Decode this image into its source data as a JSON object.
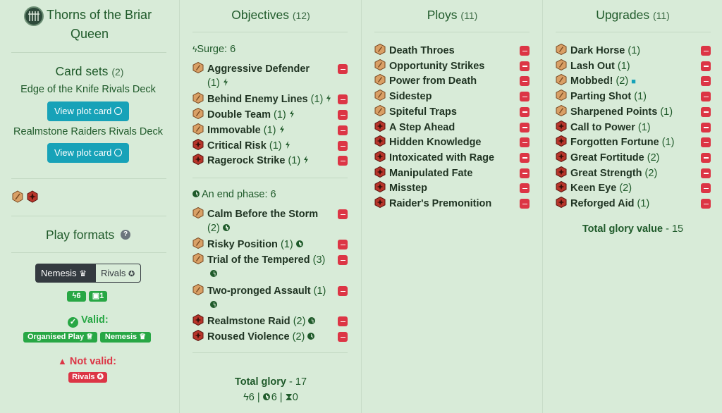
{
  "faction": {
    "name_line1": "Thorns of the Briar",
    "name_line2": "Queen",
    "icon": "briar-queen-crest-icon"
  },
  "card_sets": {
    "title": "Card sets",
    "count": "(2)",
    "sets": [
      {
        "name": "Edge of the Knife Rivals Deck",
        "button": "View plot card"
      },
      {
        "name": "Realmstone Raiders Rivals Deck",
        "button": "View plot card"
      }
    ]
  },
  "play_formats": {
    "title": "Play formats",
    "toggle": {
      "nemesis": "Nemesis",
      "rivals": "Rivals",
      "selected": "Nemesis"
    },
    "stat_surge": "6",
    "stat_lock": "1",
    "valid_label": "Valid:",
    "valid_badges": [
      "Organised Play",
      "Nemesis"
    ],
    "invalid_label": "Not valid:",
    "invalid_badges": [
      "Rivals"
    ]
  },
  "objectives": {
    "title": "Objectives",
    "count": "(12)",
    "surge_header": "Surge: 6",
    "end_header": "An end phase: 6",
    "surge_items": [
      {
        "name": "Aggressive Defender",
        "count": "(1)",
        "set": "edge"
      },
      {
        "name": "Behind Enemy Lines",
        "count": "(1)",
        "set": "edge"
      },
      {
        "name": "Double Team",
        "count": "(1)",
        "set": "edge"
      },
      {
        "name": "Immovable",
        "count": "(1)",
        "set": "edge"
      },
      {
        "name": "Critical Risk",
        "count": "(1)",
        "set": "realm"
      },
      {
        "name": "Ragerock Strike",
        "count": "(1)",
        "set": "realm"
      }
    ],
    "end_items": [
      {
        "name": "Calm Before the Storm",
        "count": "(2)",
        "set": "edge"
      },
      {
        "name": "Risky Position",
        "count": "(1)",
        "set": "edge"
      },
      {
        "name": "Trial of the Tempered",
        "count": "(3)",
        "set": "edge"
      },
      {
        "name": "Two-pronged Assault",
        "count": "(1)",
        "set": "edge"
      },
      {
        "name": "Realmstone Raid",
        "count": "(2)",
        "set": "realm"
      },
      {
        "name": "Roused Violence",
        "count": "(2)",
        "set": "realm"
      }
    ],
    "total_label": "Total glory",
    "total_value": "- 17",
    "summary": {
      "surge": "6",
      "end": "6",
      "other": "0"
    }
  },
  "ploys": {
    "title": "Ploys",
    "count": "(11)",
    "items": [
      {
        "name": "Death Throes",
        "set": "edge"
      },
      {
        "name": "Opportunity Strikes",
        "set": "edge"
      },
      {
        "name": "Power from Death",
        "set": "edge"
      },
      {
        "name": "Sidestep",
        "set": "edge"
      },
      {
        "name": "Spiteful Traps",
        "set": "edge"
      },
      {
        "name": "A Step Ahead",
        "set": "realm"
      },
      {
        "name": "Hidden Knowledge",
        "set": "realm"
      },
      {
        "name": "Intoxicated with Rage",
        "set": "realm"
      },
      {
        "name": "Manipulated Fate",
        "set": "realm"
      },
      {
        "name": "Misstep",
        "set": "realm"
      },
      {
        "name": "Raider's Premonition",
        "set": "realm"
      }
    ]
  },
  "upgrades": {
    "title": "Upgrades",
    "count": "(11)",
    "items": [
      {
        "name": "Dark Horse",
        "count": "(1)",
        "set": "edge"
      },
      {
        "name": "Lash Out",
        "count": "(1)",
        "set": "edge"
      },
      {
        "name": "Mobbed!",
        "count": "(2)",
        "set": "edge",
        "locked": true
      },
      {
        "name": "Parting Shot",
        "count": "(1)",
        "set": "edge"
      },
      {
        "name": "Sharpened Points",
        "count": "(1)",
        "set": "edge"
      },
      {
        "name": "Call to Power",
        "count": "(1)",
        "set": "realm"
      },
      {
        "name": "Forgotten Fortune",
        "count": "(1)",
        "set": "realm"
      },
      {
        "name": "Great Fortitude",
        "count": "(2)",
        "set": "realm"
      },
      {
        "name": "Great Strength",
        "count": "(2)",
        "set": "realm"
      },
      {
        "name": "Keen Eye",
        "count": "(2)",
        "set": "realm"
      },
      {
        "name": "Reforged Aid",
        "count": "(1)",
        "set": "realm"
      }
    ],
    "total_label": "Total glory value",
    "total_value": "- 15"
  },
  "colors": {
    "edge": "#d9a066",
    "realm": "#b8352a",
    "remove": "#dc3545",
    "accent": "#17a2b8",
    "valid": "#28a745"
  }
}
